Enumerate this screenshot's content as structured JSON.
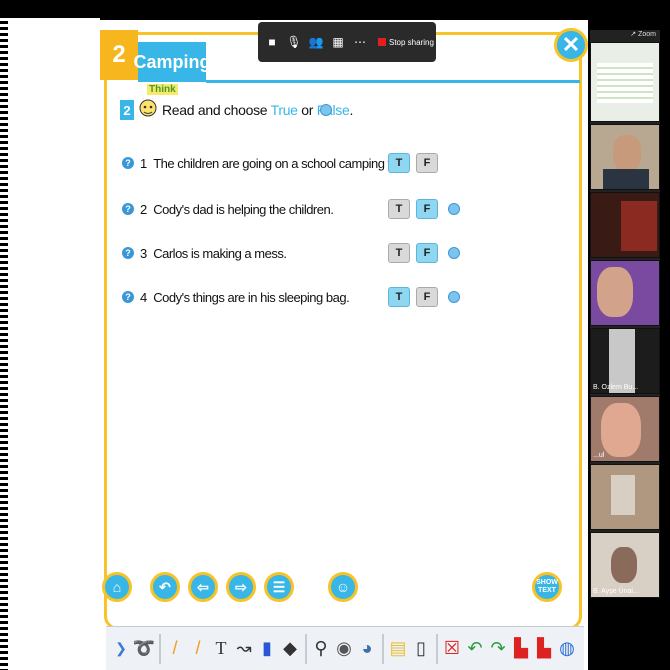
{
  "lesson": {
    "number": "2",
    "title": "Camping",
    "close_icon": "close-icon"
  },
  "exercise": {
    "number": "2",
    "think_label": "Think",
    "instruction_before": "Read and choose ",
    "instruction_true": "True",
    "instruction_or": " or ",
    "instruction_false": "False",
    "instruction_end": "."
  },
  "questions": [
    {
      "num": "1",
      "text": "The children are going on a school camping trip.",
      "selected": "T"
    },
    {
      "num": "2",
      "text": "Cody's dad is helping the children.",
      "selected": "F"
    },
    {
      "num": "3",
      "text": "Carlos is making a mess.",
      "selected": "F"
    },
    {
      "num": "4",
      "text": "Cody's things are in his sleeping bag.",
      "selected": "T"
    }
  ],
  "tf_labels": {
    "true": "T",
    "false": "F"
  },
  "nav": {
    "show_text_label_1": "SHOW",
    "show_text_label_2": "TEXT"
  },
  "meeting_bar": {
    "stop_sharing_label": "Stop sharing",
    "more_label": "⋯"
  },
  "participants": {
    "header": "↗ Zoom",
    "names": [
      "",
      "",
      "",
      "B. Ozlem Bu...",
      "...ul",
      "",
      "B. Ayşe Ünal..."
    ]
  },
  "colors": {
    "accent_blue": "#38b6e8",
    "accent_yellow": "#f7c326",
    "stop_red": "#e02020"
  }
}
